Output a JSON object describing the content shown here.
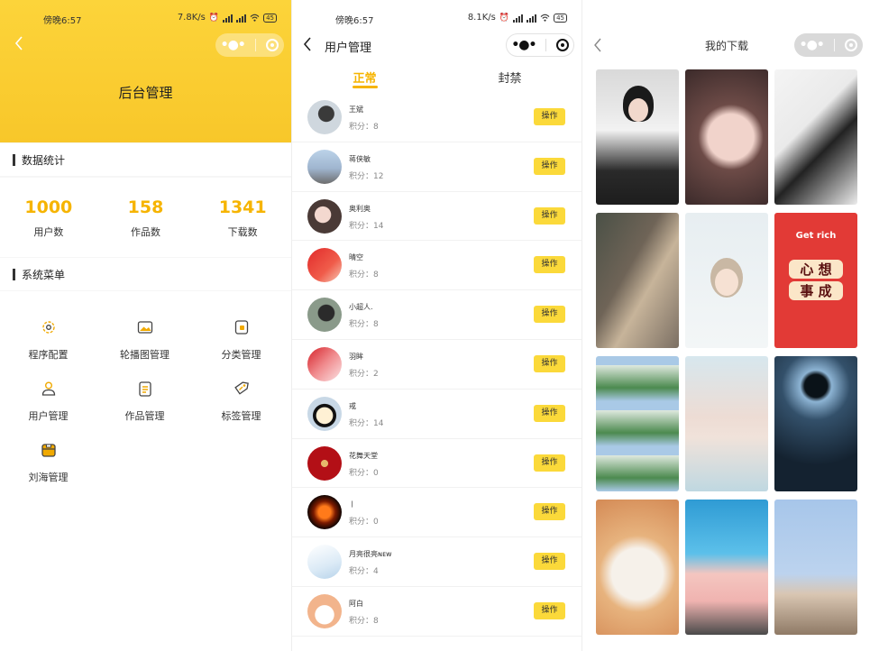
{
  "panel1": {
    "status": {
      "time": "傍晚6:57",
      "speed": "7.8K/s",
      "battery": "45"
    },
    "title": "后台管理",
    "stats_heading": "数据统计",
    "stats": [
      {
        "value": "1000",
        "label": "用户数"
      },
      {
        "value": "158",
        "label": "作品数"
      },
      {
        "value": "1341",
        "label": "下载数"
      }
    ],
    "menu_heading": "系统菜单",
    "menu": [
      {
        "label": "程序配置",
        "icon": "gear-icon"
      },
      {
        "label": "轮播图管理",
        "icon": "image-icon"
      },
      {
        "label": "分类管理",
        "icon": "category-icon"
      },
      {
        "label": "用户管理",
        "icon": "user-icon"
      },
      {
        "label": "作品管理",
        "icon": "document-icon"
      },
      {
        "label": "标签管理",
        "icon": "tag-icon"
      },
      {
        "label": "刘海管理",
        "icon": "notch-icon"
      }
    ],
    "accent": "#f6b400",
    "header_color": "#fcd43a"
  },
  "panel2": {
    "status": {
      "time": "傍晚6:57",
      "speed": "8.1K/s",
      "battery": "45"
    },
    "title": "用户管理",
    "tabs": [
      {
        "label": "正常"
      },
      {
        "label": "封禁"
      }
    ],
    "op_label": "操作",
    "users": [
      {
        "name": "王斌",
        "score": "积分：8"
      },
      {
        "name": "蒋侠敏",
        "score": "积分：12"
      },
      {
        "name": "奥利奥",
        "score": "积分：14"
      },
      {
        "name": "晴空",
        "score": "积分：8"
      },
      {
        "name": "小超人.",
        "score": "积分：8"
      },
      {
        "name": "羽眸",
        "score": "积分：2"
      },
      {
        "name": "戒",
        "score": "积分：14"
      },
      {
        "name": "花舞天堂",
        "score": "积分：0"
      },
      {
        "name": "ㅣ",
        "score": "积分：0"
      },
      {
        "name": "月亮很亮ɴᴇᴡ",
        "score": "积分：4"
      },
      {
        "name": "阿白",
        "score": "积分：8"
      }
    ]
  },
  "panel3": {
    "title": "我的下载",
    "overlay_text": {
      "get_rich": "Get rich",
      "wish1": "心 想",
      "wish2": "事 成"
    }
  }
}
